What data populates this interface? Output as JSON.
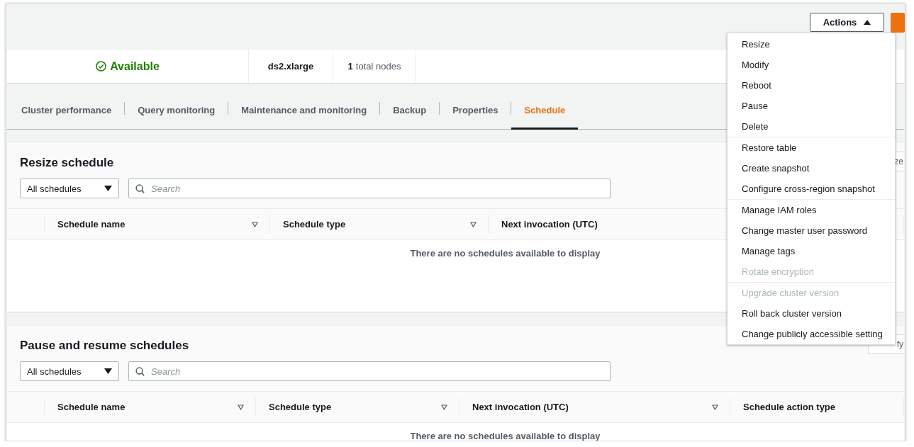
{
  "actions_button": {
    "label": "Actions",
    "expanded": true
  },
  "summary": {
    "status": "Available",
    "node_type": "ds2.xlarge",
    "node_count": "1",
    "node_count_label": "total nodes"
  },
  "tabs": [
    {
      "label": "Cluster performance",
      "selected": false
    },
    {
      "label": "Query monitoring",
      "selected": false
    },
    {
      "label": "Maintenance and monitoring",
      "selected": false
    },
    {
      "label": "Backup",
      "selected": false
    },
    {
      "label": "Properties",
      "selected": false
    },
    {
      "label": "Schedule",
      "selected": true
    }
  ],
  "panels": [
    {
      "title": "Resize schedule",
      "filter": "All schedules",
      "search": {
        "placeholder": "Search"
      },
      "side_button": "ze",
      "columns": [
        {
          "label": "Schedule name",
          "sortable": true
        },
        {
          "label": "Schedule type",
          "sortable": true
        },
        {
          "label": "Next invocation (UTC)"
        }
      ],
      "empty_message": "There are no schedules available to display"
    },
    {
      "title": "Pause and resume schedules",
      "filter": "All schedules",
      "search": {
        "placeholder": "Search"
      },
      "side_button": "fy",
      "columns": [
        {
          "label": "Schedule name",
          "sortable": true
        },
        {
          "label": "Schedule type",
          "sortable": true
        },
        {
          "label": "Next invocation (UTC)",
          "sortable": true
        },
        {
          "label": "Schedule action type",
          "sortable": false
        }
      ],
      "empty_message": "There are no schedules available to display"
    }
  ],
  "actions_menu": {
    "groups": [
      [
        {
          "label": "Resize",
          "disabled": false
        },
        {
          "label": "Modify",
          "disabled": false
        },
        {
          "label": "Reboot",
          "disabled": false
        },
        {
          "label": "Pause",
          "disabled": false
        },
        {
          "label": "Delete",
          "disabled": false
        }
      ],
      [
        {
          "label": "Restore table",
          "disabled": false
        },
        {
          "label": "Create snapshot",
          "disabled": false
        },
        {
          "label": "Configure cross-region snapshot",
          "disabled": false
        }
      ],
      [
        {
          "label": "Manage IAM roles",
          "disabled": false
        },
        {
          "label": "Change master user password",
          "disabled": false
        },
        {
          "label": "Manage tags",
          "disabled": false
        },
        {
          "label": "Rotate encryption",
          "disabled": true
        }
      ],
      [
        {
          "label": "Upgrade cluster version",
          "disabled": true
        },
        {
          "label": "Roll back cluster version",
          "disabled": false
        },
        {
          "label": "Change publicly accessible setting",
          "disabled": false
        }
      ]
    ]
  }
}
